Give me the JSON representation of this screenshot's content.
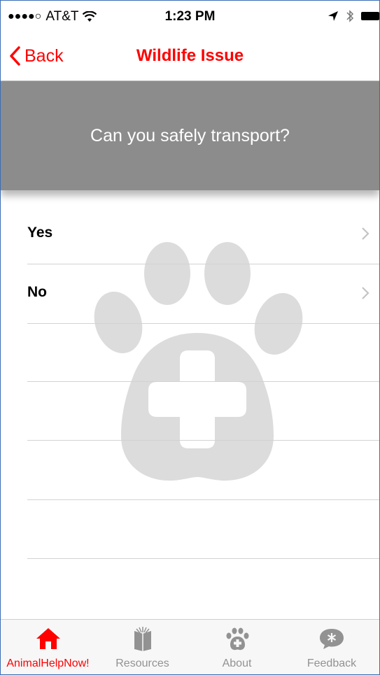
{
  "status_bar": {
    "signal": "●●●●○",
    "carrier": "AT&T",
    "time": "1:23 PM"
  },
  "nav": {
    "back_label": "Back",
    "title": "Wildlife Issue"
  },
  "question": "Can you safely transport?",
  "options": [
    {
      "label": "Yes"
    },
    {
      "label": "No"
    }
  ],
  "tabs": [
    {
      "label": "AnimalHelpNow!",
      "icon": "house-icon",
      "active": true
    },
    {
      "label": "Resources",
      "icon": "book-icon",
      "active": false
    },
    {
      "label": "About",
      "icon": "paw-cross-icon",
      "active": false
    },
    {
      "label": "Feedback",
      "icon": "speech-bubble-icon",
      "active": false
    }
  ],
  "colors": {
    "accent": "#ff0000",
    "banner": "#8c8c8c",
    "watermark": "#dcdcdc",
    "inactive_tab": "#929292"
  }
}
